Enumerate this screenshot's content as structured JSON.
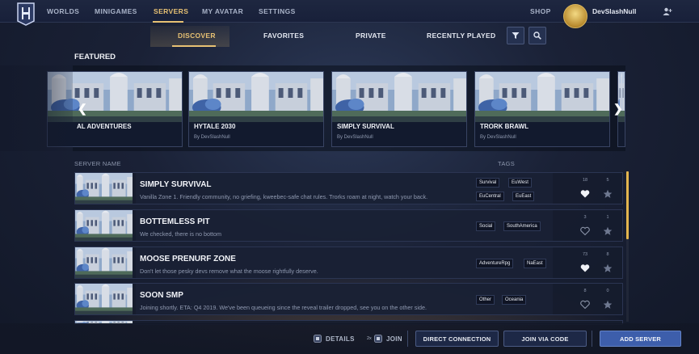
{
  "topnav": {
    "items": [
      "WORLDS",
      "MINIGAMES",
      "SERVERS",
      "MY AVATAR",
      "SETTINGS"
    ],
    "shop": "SHOP",
    "username": "DevSlashNull"
  },
  "subtabs": [
    "DISCOVER",
    "FAVORITES",
    "PRIVATE",
    "RECENTLY PLAYED"
  ],
  "featured": {
    "title": "FEATURED",
    "cards": [
      {
        "title": "AL ADVENTURES",
        "by": ""
      },
      {
        "title": "HYTALE 2030",
        "by": "By DevSlashNull"
      },
      {
        "title": "SIMPLY SURVIVAL",
        "by": "By DevSlashNull"
      },
      {
        "title": "TRORK BRAWL",
        "by": "By DevSlashNull"
      }
    ]
  },
  "list": {
    "col_name": "SERVER NAME",
    "col_tags": "TAGS",
    "rows": [
      {
        "name": "SIMPLY SURVIVAL",
        "desc": "Vanilla Zone 1. Friendly community, no griefing, kweebec-safe chat rules. Trorks roam at night, watch your back.",
        "tags": [
          "Survival",
          "EuWest",
          "EuCentral",
          "EuEast"
        ],
        "likes": "18",
        "stars": "5",
        "liked": true
      },
      {
        "name": "BOTTEMLESS PIT",
        "desc": "We checked, there is no bottom",
        "tags": [
          "Social",
          "SouthAmerica"
        ],
        "likes": "3",
        "stars": "1",
        "liked": false
      },
      {
        "name": "MOOSE PRENURF ZONE",
        "desc": "Don't let those pesky devs remove what the moose rightfully deserve.",
        "tags": [
          "AdventureRpg",
          "NaEast"
        ],
        "likes": "73",
        "stars": "8",
        "liked": true
      },
      {
        "name": "SOON SMP",
        "desc": "Joining shortly. ETA: Q4 2019. We've been queueing since the reveal trailer dropped, see you on the other side.",
        "tags": [
          "Other",
          "Oceania"
        ],
        "likes": "8",
        "stars": "0",
        "liked": false
      }
    ]
  },
  "bottom": {
    "details": "DETAILS",
    "join_hint": "2x",
    "join": "JOIN",
    "direct": "DIRECT CONNECTION",
    "via_code": "JOIN VIA CODE",
    "add": "ADD SERVER"
  },
  "colors": {
    "accent": "#e7c173",
    "primary": "#3d5eab"
  }
}
